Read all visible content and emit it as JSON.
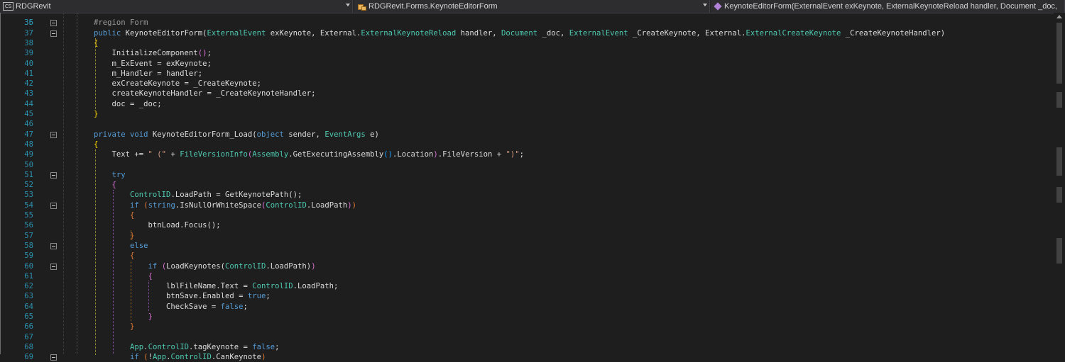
{
  "navbar": {
    "project": "RDGRevit",
    "project_icon": "CS",
    "class": "RDGRevit.Forms.KeynoteEditorForm",
    "member": "KeynoteEditorForm(ExternalEvent exKeynote, ExternalKeynoteReload handler, Document _doc, Exter"
  },
  "top_partial_line_number": "35",
  "lines": [
    {
      "n": "36",
      "fold": true,
      "guides": [],
      "tokens": [
        [
          "pr",
          "#region Form"
        ]
      ]
    },
    {
      "n": "37",
      "fold": true,
      "guides": [],
      "tokens": [
        [
          "kw",
          "public "
        ],
        [
          "",
          "KeynoteEditorForm("
        ],
        [
          "ty",
          "ExternalEvent"
        ],
        [
          "",
          " exKeynote, External."
        ],
        [
          "ty",
          "ExternalKeynoteReload"
        ],
        [
          "",
          " handler, "
        ],
        [
          "ty",
          "Document"
        ],
        [
          "",
          " _doc, "
        ],
        [
          "ty",
          "ExternalEvent"
        ],
        [
          "",
          " _CreateKeynote, External."
        ],
        [
          "ty",
          "ExternalCreateKeynote"
        ],
        [
          "",
          " _CreateKeynoteHandler)"
        ]
      ]
    },
    {
      "n": "38",
      "guides": [],
      "tokens": [
        [
          "br-gold",
          "{"
        ]
      ]
    },
    {
      "n": "39",
      "guides": [],
      "tokens": [
        [
          "",
          "    InitializeComponent"
        ],
        [
          "br-purple",
          "()"
        ],
        [
          "",
          ";"
        ]
      ]
    },
    {
      "n": "40",
      "guides": [],
      "tokens": [
        [
          "",
          "    m_ExEvent = exKeynote;"
        ]
      ]
    },
    {
      "n": "41",
      "guides": [],
      "tokens": [
        [
          "",
          "    m_Handler = handler;"
        ]
      ]
    },
    {
      "n": "42",
      "guides": [],
      "tokens": [
        [
          "",
          "    exCreateKeynote = _CreateKeynote;"
        ]
      ]
    },
    {
      "n": "43",
      "guides": [],
      "tokens": [
        [
          "",
          "    createKeynoteHandler = _CreateKeynoteHandler;"
        ]
      ]
    },
    {
      "n": "44",
      "guides": [],
      "tokens": [
        [
          "",
          "    doc = _doc;"
        ]
      ]
    },
    {
      "n": "45",
      "guides": [],
      "tokens": [
        [
          "br-gold",
          "}"
        ]
      ]
    },
    {
      "n": "46",
      "guides": [],
      "tokens": []
    },
    {
      "n": "47",
      "fold": true,
      "guides": [],
      "tokens": [
        [
          "kw",
          "private void "
        ],
        [
          "",
          "KeynoteEditorForm_Load("
        ],
        [
          "kw",
          "object"
        ],
        [
          "",
          " sender, "
        ],
        [
          "ty",
          "EventArgs"
        ],
        [
          "",
          " e)"
        ]
      ]
    },
    {
      "n": "48",
      "guides": [],
      "tokens": [
        [
          "br-gold",
          "{"
        ]
      ]
    },
    {
      "n": "49",
      "guides": [],
      "tokens": [
        [
          "",
          "    Text += "
        ],
        [
          "st",
          "\" (\""
        ],
        [
          "",
          " + "
        ],
        [
          "ty",
          "FileVersionInfo"
        ],
        [
          ".GetVersionInfo"
        ],
        [
          "br-purple",
          "("
        ],
        [
          "ty",
          "Assembly"
        ],
        [
          "",
          ".GetExecutingAssembly"
        ],
        [
          "br-blue",
          "()"
        ],
        [
          "",
          ".Location"
        ],
        [
          "br-purple",
          ")"
        ],
        [
          "",
          ".FileVersion + "
        ],
        [
          "st",
          "\")\""
        ],
        [
          "",
          ";"
        ]
      ]
    },
    {
      "n": "50",
      "guides": [],
      "tokens": []
    },
    {
      "n": "51",
      "fold": true,
      "guides": [],
      "tokens": [
        [
          "",
          "    "
        ],
        [
          "kw",
          "try"
        ]
      ]
    },
    {
      "n": "52",
      "guides": [],
      "tokens": [
        [
          "",
          "    "
        ],
        [
          "br-purple",
          "{"
        ]
      ]
    },
    {
      "n": "53",
      "guides": [],
      "tokens": [
        [
          "",
          "        "
        ],
        [
          "ty",
          "ControlID"
        ],
        [
          "",
          ".LoadPath = GetKeynotePath();"
        ]
      ]
    },
    {
      "n": "54",
      "fold": true,
      "guides": [],
      "tokens": [
        [
          "",
          "        "
        ],
        [
          "kw",
          "if "
        ],
        [
          "br-orange",
          "("
        ],
        [
          "kw",
          "string"
        ],
        [
          "",
          ".IsNullOrWhiteSpace"
        ],
        [
          "br-purple",
          "("
        ],
        [
          "ty",
          "ControlID"
        ],
        [
          "",
          ".LoadPath"
        ],
        [
          "br-purple",
          ")"
        ],
        [
          "br-orange",
          ")"
        ]
      ]
    },
    {
      "n": "55",
      "guides": [],
      "tokens": [
        [
          "",
          "        "
        ],
        [
          "br-orange",
          "{"
        ]
      ]
    },
    {
      "n": "56",
      "guides": [],
      "tokens": [
        [
          "",
          "            btnLoad.Focus();"
        ]
      ]
    },
    {
      "n": "57",
      "guides": [],
      "tokens": [
        [
          "",
          "        "
        ],
        [
          "br-orange",
          "}"
        ]
      ]
    },
    {
      "n": "58",
      "fold": true,
      "guides": [],
      "tokens": [
        [
          "",
          "        "
        ],
        [
          "kw",
          "else"
        ]
      ]
    },
    {
      "n": "59",
      "guides": [],
      "tokens": [
        [
          "",
          "        "
        ],
        [
          "br-orange",
          "{"
        ]
      ]
    },
    {
      "n": "60",
      "fold": true,
      "guides": [],
      "tokens": [
        [
          "",
          "            "
        ],
        [
          "kw",
          "if "
        ],
        [
          "br-purple",
          "("
        ],
        [
          "",
          "LoadKeynotes("
        ],
        [
          "ty",
          "ControlID"
        ],
        [
          "",
          ".LoadPath)"
        ],
        [
          "br-purple",
          ")"
        ]
      ]
    },
    {
      "n": "61",
      "guides": [],
      "tokens": [
        [
          "",
          "            "
        ],
        [
          "br-purple",
          "{"
        ]
      ]
    },
    {
      "n": "62",
      "guides": [],
      "tokens": [
        [
          "",
          "                lblFileName.Text = "
        ],
        [
          "ty",
          "ControlID"
        ],
        [
          "",
          ".LoadPath;"
        ]
      ]
    },
    {
      "n": "63",
      "guides": [],
      "tokens": [
        [
          "",
          "                btnSave.Enabled = "
        ],
        [
          "kw",
          "true"
        ],
        [
          "",
          ";"
        ]
      ]
    },
    {
      "n": "64",
      "guides": [],
      "tokens": [
        [
          "",
          "                CheckSave = "
        ],
        [
          "kw",
          "false"
        ],
        [
          "",
          ";"
        ]
      ]
    },
    {
      "n": "65",
      "guides": [],
      "tokens": [
        [
          "",
          "            "
        ],
        [
          "br-purple",
          "}"
        ]
      ]
    },
    {
      "n": "66",
      "guides": [],
      "tokens": [
        [
          "",
          "        "
        ],
        [
          "br-orange",
          "}"
        ]
      ]
    },
    {
      "n": "67",
      "guides": [],
      "tokens": []
    },
    {
      "n": "68",
      "guides": [],
      "tokens": [
        [
          "",
          "        "
        ],
        [
          "ty",
          "App"
        ],
        [
          "",
          "."
        ],
        [
          "ty",
          "ControlID"
        ],
        [
          "",
          ".tagKeynote = "
        ],
        [
          "kw",
          "false"
        ],
        [
          "",
          ";"
        ]
      ]
    },
    {
      "n": "69",
      "fold": true,
      "guides": [],
      "tokens": [
        [
          "",
          "        "
        ],
        [
          "kw",
          "if "
        ],
        [
          "br-orange",
          "("
        ],
        [
          "",
          "!"
        ],
        [
          "ty",
          "App"
        ],
        [
          "",
          "."
        ],
        [
          "ty",
          "ControlID"
        ],
        [
          "",
          ".CanKeynote"
        ],
        [
          "br-orange",
          ")"
        ]
      ]
    }
  ]
}
